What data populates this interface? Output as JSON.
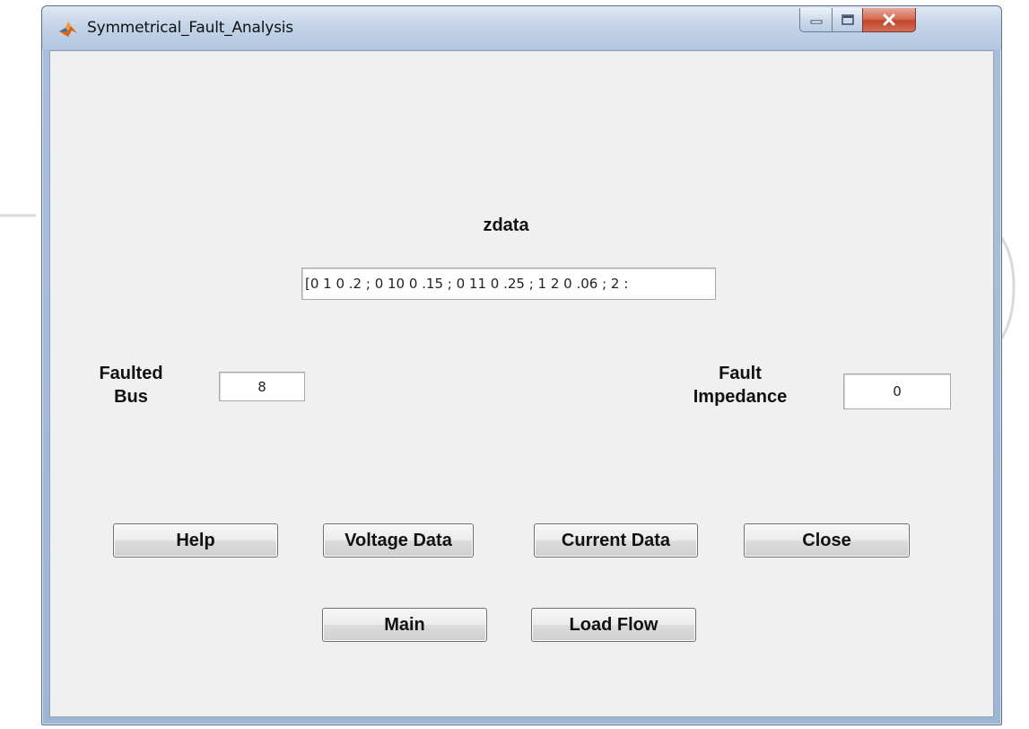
{
  "window": {
    "title": "Symmetrical_Fault_Analysis"
  },
  "zdata": {
    "label": "zdata",
    "value": "[0 1 0 .2 ; 0 10 0 .15 ; 0 11 0 .25 ; 1 2 0 .06 ; 2 :"
  },
  "faulted_bus": {
    "label_line1": "Faulted",
    "label_line2": "Bus",
    "value": "8"
  },
  "fault_impedance": {
    "label_line1": "Fault",
    "label_line2": "Impedance",
    "value": "0"
  },
  "buttons": {
    "help": "Help",
    "voltage_data": "Voltage Data",
    "current_data": "Current Data",
    "close": "Close",
    "main": "Main",
    "load_flow": "Load Flow"
  },
  "icons": {
    "app": "matlab-icon",
    "minimize": "minimize-icon",
    "maximize": "maximize-icon",
    "close": "close-icon"
  },
  "colors": {
    "client_bg": "#f0f0f0",
    "close_button": "#c2452b"
  }
}
